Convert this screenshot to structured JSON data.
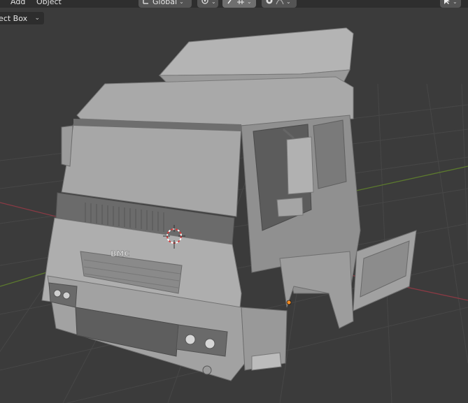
{
  "header": {
    "menus": [
      {
        "label": "Add"
      },
      {
        "label": "Object"
      }
    ],
    "transform_orientation": {
      "label": "Global",
      "icon": "transform-orientation-icon"
    },
    "pivot": {
      "icon": "pivot-point-icon"
    },
    "snapping": {
      "icon": "snap-magnet-icon",
      "icon2": "snap-grid-icon"
    },
    "proportional": {
      "icon": "proportional-editing-icon",
      "icon2": "falloff-curve-icon"
    },
    "select_tool": {
      "icon": "cursor-arrow-icon"
    }
  },
  "toolbar": {
    "select_mode": {
      "label": "lect Box"
    }
  },
  "viewport": {
    "model": "truck-cab-mesh",
    "logo_text": "BMC",
    "colors": {
      "background": "#3b3b3b",
      "grid": "#474747",
      "x_axis": "#8a3a44",
      "y_axis": "#5c7a2e",
      "mesh": "#a3a3a3",
      "mesh_dark": "#5a5a5a",
      "origin": "#f08a24",
      "cursor_red": "#d33a3a"
    }
  }
}
